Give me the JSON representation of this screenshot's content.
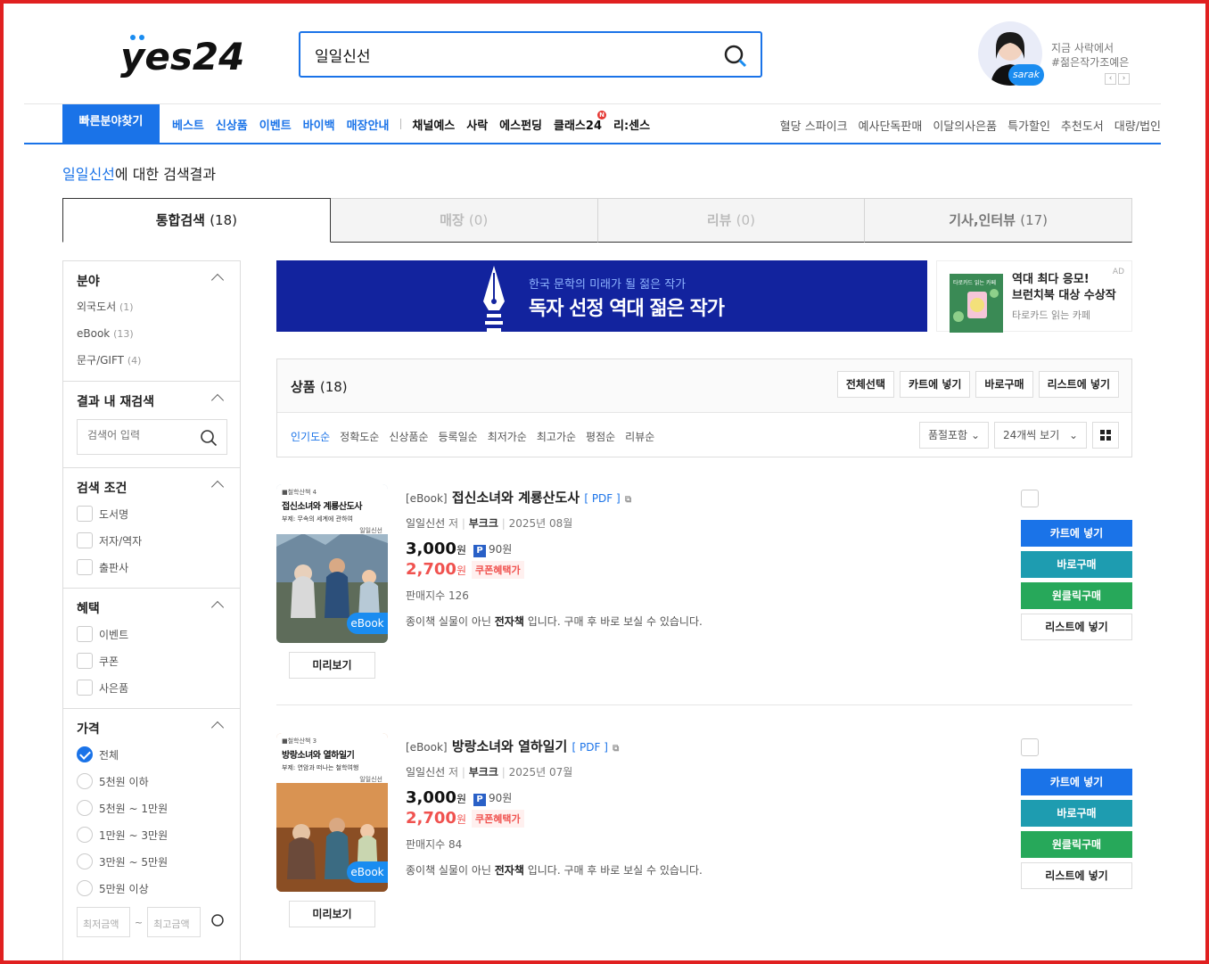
{
  "header": {
    "logo_text": "yes24",
    "search_value": "일일신선",
    "author_banner": {
      "line1": "지금 사락에서",
      "line2": "#젊은작가조예은",
      "badge": "sarak"
    }
  },
  "gnb": {
    "quick": "빠른분야찾기",
    "blue_items": [
      "베스트",
      "신상품",
      "이벤트",
      "바이백",
      "매장안내"
    ],
    "dark_items": [
      "채널예스",
      "사락",
      "에스펀딩",
      "클래스24",
      "리:센스"
    ],
    "new_badge": "N",
    "right_items": [
      "혈당 스파이크",
      "예사단독판매",
      "이달의사은품",
      "특가할인",
      "추천도서",
      "대량/법인"
    ]
  },
  "result": {
    "keyword": "일일신선",
    "suffix": "에 대한 검색결과"
  },
  "tabs": [
    {
      "label": "통합검색",
      "count": "(18)"
    },
    {
      "label": "매장",
      "count": "(0)"
    },
    {
      "label": "리뷰",
      "count": "(0)"
    },
    {
      "label": "기사,인터뷰",
      "count": "(17)"
    }
  ],
  "sidebar": {
    "category": {
      "title": "분야",
      "items": [
        {
          "label": "외국도서",
          "count": "(1)"
        },
        {
          "label": "eBook",
          "count": "(13)"
        },
        {
          "label": "문구/GIFT",
          "count": "(4)"
        }
      ]
    },
    "research": {
      "title": "결과 내 재검색",
      "placeholder": "검색어 입력"
    },
    "condition": {
      "title": "검색 조건",
      "items": [
        "도서명",
        "저자/역자",
        "출판사"
      ]
    },
    "benefit": {
      "title": "혜택",
      "items": [
        "이벤트",
        "쿠폰",
        "사은품"
      ]
    },
    "price": {
      "title": "가격",
      "items": [
        "전체",
        "5천원 이하",
        "5천원 ~ 1만원",
        "1만원 ~ 3만원",
        "3만원 ~ 5만원",
        "5만원 이상"
      ],
      "min_placeholder": "최저금액",
      "max_placeholder": "최고금액",
      "sep": "~"
    }
  },
  "ads": {
    "main": {
      "line1": "한국 문학의 미래가 될 젊은 작가",
      "line2": "독자 선정 역대 젊은 작가"
    },
    "side": {
      "line1": "역대 최다 응모!",
      "line2": "브런치북 대상 수상작",
      "line3": "타로카드 읽는 카페",
      "tag": "AD",
      "cover_text": "타로카드 읽는 카페"
    }
  },
  "products": {
    "title": "상품",
    "count": "(18)",
    "buttons": [
      "전체선택",
      "카트에 넣기",
      "바로구매",
      "리스트에 넣기"
    ],
    "sorts": [
      "인기도순",
      "정확도순",
      "신상품순",
      "등록일순",
      "최저가순",
      "최고가순",
      "평점순",
      "리뷰순"
    ],
    "filter": "품절포함",
    "per_page": "24개씩 보기"
  },
  "items": [
    {
      "type_tag": "[eBook]",
      "title": "접신소녀와 계룡산도사",
      "format": "[ PDF ]",
      "author": "일일신선",
      "author_suffix": "저",
      "publisher": "부크크",
      "date": "2025년 08월",
      "price": "3,000",
      "won": "원",
      "point_icon": "P",
      "point": "90원",
      "sale_price": "2,700",
      "coupon": "쿠폰혜택가",
      "sales": "판매지수 126",
      "desc_pre": "종이책 실물이 아닌 ",
      "desc_bold": "전자책",
      "desc_post": " 입니다. 구매 후 바로 보실 수 있습니다.",
      "badge": "eBook",
      "preview": "미리보기",
      "cover": {
        "series": "■철학산책 4",
        "title": "접신소녀와 계룡산도사",
        "subtitle": "부제: 무속의 세계에 관하여",
        "author": "일일신선"
      },
      "buttons": [
        "카트에 넣기",
        "바로구매",
        "원클릭구매",
        "리스트에 넣기"
      ]
    },
    {
      "type_tag": "[eBook]",
      "title": "방랑소녀와 열하일기",
      "format": "[ PDF ]",
      "author": "일일신선",
      "author_suffix": "저",
      "publisher": "부크크",
      "date": "2025년 07월",
      "price": "3,000",
      "won": "원",
      "point_icon": "P",
      "point": "90원",
      "sale_price": "2,700",
      "coupon": "쿠폰혜택가",
      "sales": "판매지수 84",
      "desc_pre": "종이책 실물이 아닌 ",
      "desc_bold": "전자책",
      "desc_post": " 입니다. 구매 후 바로 보실 수 있습니다.",
      "badge": "eBook",
      "preview": "미리보기",
      "cover": {
        "series": "■철학산책 3",
        "title": "방랑소녀와 열하일기",
        "subtitle": "부제: 연암과 떠나는 철학여행",
        "author": "일일신선"
      },
      "buttons": [
        "카트에 넣기",
        "바로구매",
        "원클릭구매",
        "리스트에 넣기"
      ]
    }
  ]
}
